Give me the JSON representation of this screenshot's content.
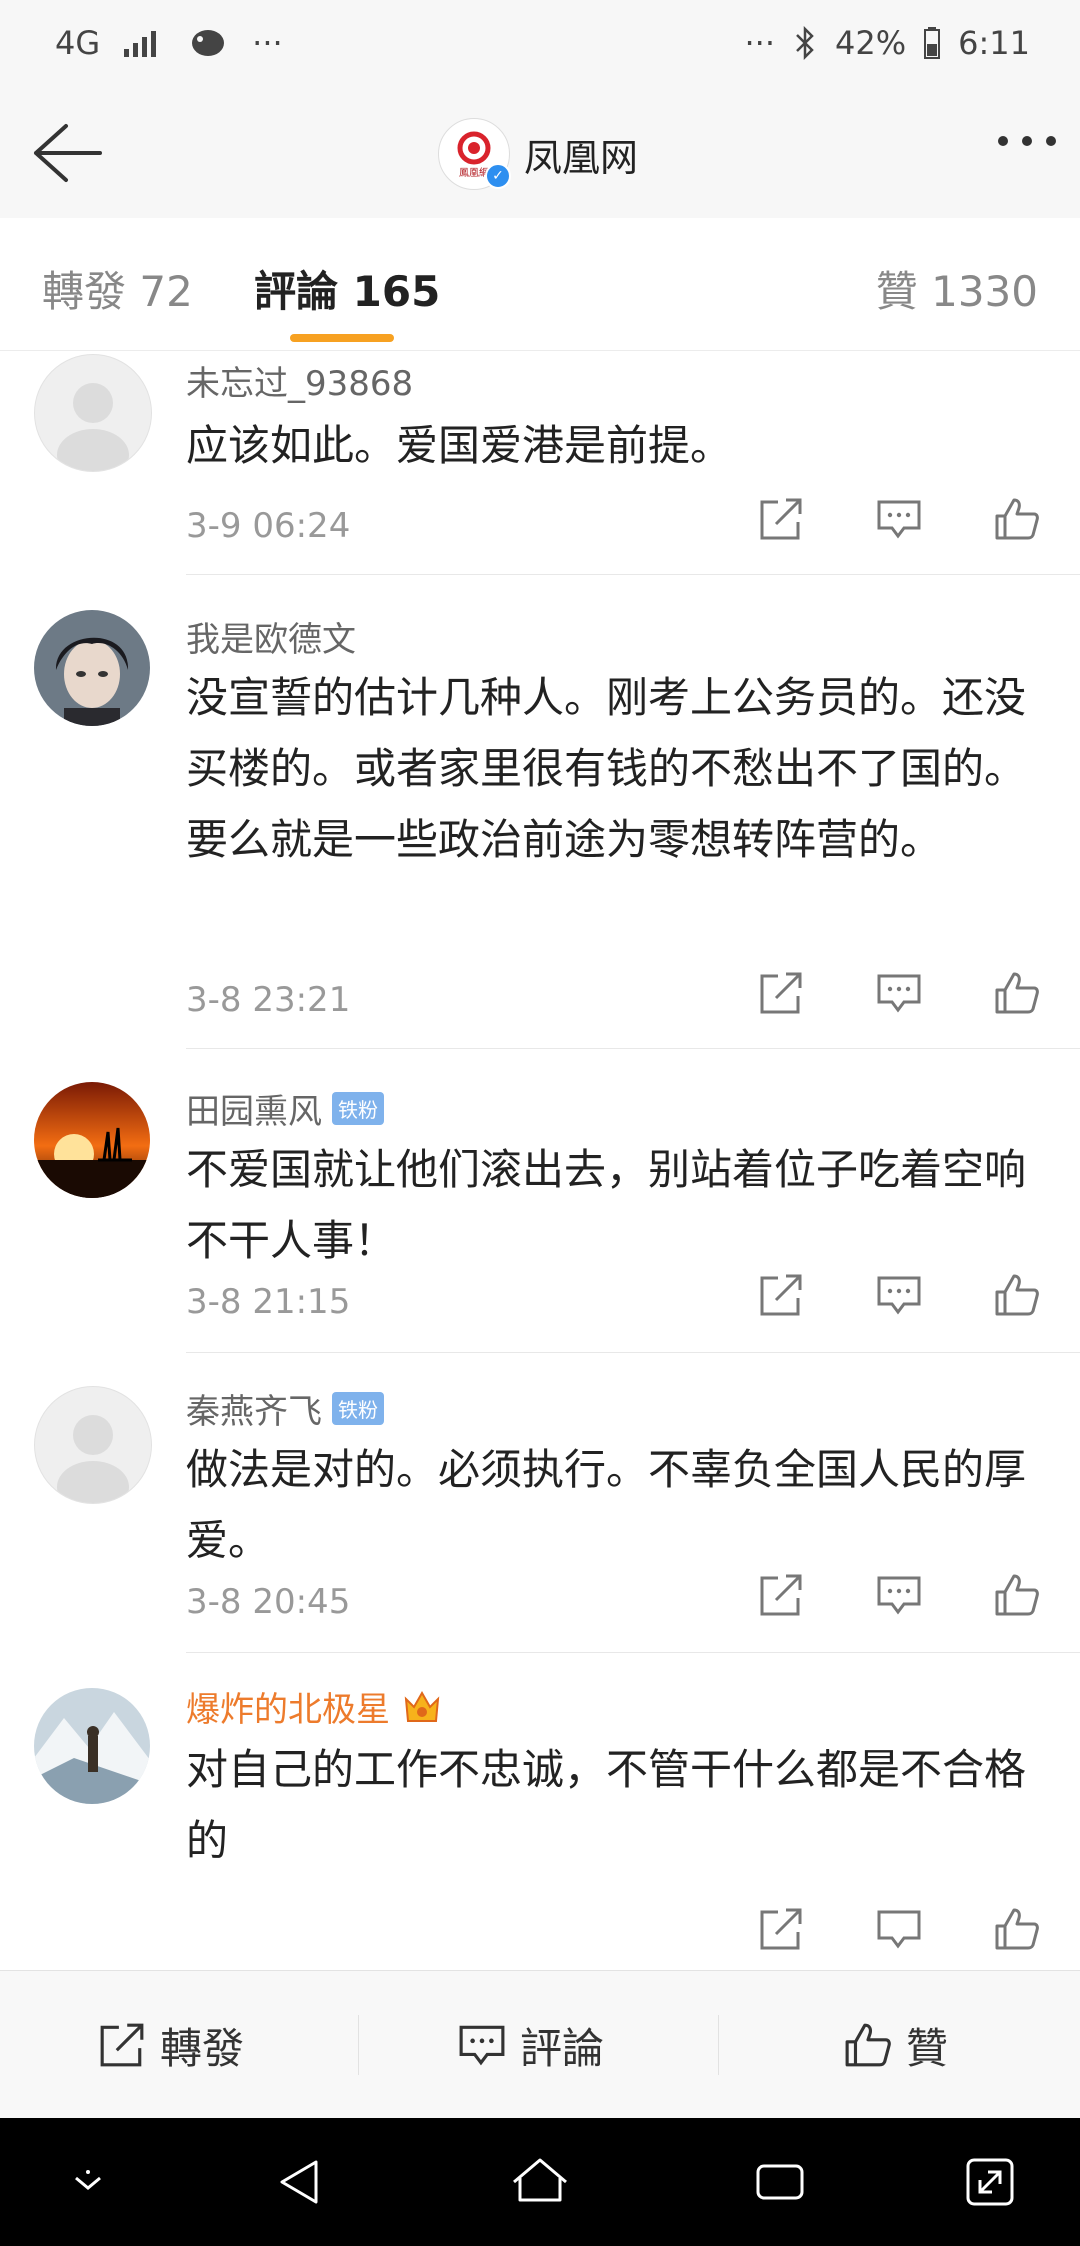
{
  "status_bar": {
    "network": "4G",
    "battery": "42%",
    "time": "6:11",
    "left_more": "···",
    "right_more": "···"
  },
  "header": {
    "title": "凤凰网",
    "logo_text": "鳳凰網"
  },
  "tabs": [
    {
      "label": "轉發 72",
      "active": false
    },
    {
      "label": "評論 165",
      "active": true
    },
    {
      "label": "贊 1330",
      "active": false
    }
  ],
  "comments": [
    {
      "name": "未忘过_93868",
      "text": "应该如此。爱国爱港是前提。",
      "time": "3-9 06:24",
      "badge": ""
    },
    {
      "name": "我是欧德文",
      "text": "没宣誓的估计几种人。刚考上公务员的。还没买楼的。或者家里很有钱的不愁出不了国的。要么就是一些政治前途为零想转阵营的。",
      "time": "3-8 23:21",
      "badge": ""
    },
    {
      "name": "田园熏风",
      "text": "不爱国就让他们滚出去，别站着位子吃着空响不干人事！",
      "time": "3-8 21:15",
      "badge": "铁粉"
    },
    {
      "name": "秦燕齐飞",
      "text": "做法是对的。必须执行。不辜负全国人民的厚爱。",
      "time": "3-8 20:45",
      "badge": "铁粉"
    },
    {
      "name": "爆炸的北极星",
      "text": "对自己的工作不忠诚，不管干什么都是不合格的",
      "time": "",
      "badge": ""
    }
  ],
  "bottom_bar": {
    "repost": "轉發",
    "comment": "評論",
    "like": "贊"
  },
  "colors": {
    "accent": "#f7a121",
    "vip_name": "#ed7b2c",
    "fan_badge": "#7fb2ec"
  }
}
